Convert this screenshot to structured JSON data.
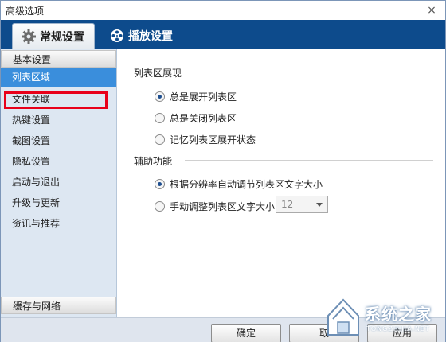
{
  "window": {
    "title": "高级选项",
    "close_glyph": "×"
  },
  "tabs": [
    {
      "label": "常规设置",
      "icon": "gear-icon",
      "active": true
    },
    {
      "label": "播放设置",
      "icon": "film-reel-icon",
      "active": false
    }
  ],
  "sidebar": {
    "top_header": "基本设置",
    "items": [
      {
        "label": "列表区域",
        "selected": true
      },
      {
        "label": "文件关联",
        "selected": false
      },
      {
        "label": "热键设置",
        "selected": false
      },
      {
        "label": "截图设置",
        "selected": false
      },
      {
        "label": "隐私设置",
        "selected": false
      },
      {
        "label": "启动与退出",
        "selected": false
      },
      {
        "label": "升级与更新",
        "selected": false
      },
      {
        "label": "资讯与推荐",
        "selected": false
      }
    ],
    "bottom_header": "缓存与网络"
  },
  "main": {
    "section1": {
      "title": "列表区展现",
      "options": [
        {
          "label": "总是展开列表区",
          "checked": true
        },
        {
          "label": "总是关闭列表区",
          "checked": false
        },
        {
          "label": "记忆列表区展开状态",
          "checked": false
        }
      ]
    },
    "section2": {
      "title": "辅助功能",
      "options": [
        {
          "label": "根据分辨率自动调节列表区文字大小",
          "checked": true
        },
        {
          "label": "手动调整列表区文字大小",
          "checked": false
        }
      ],
      "font_size_select": {
        "value": "12"
      }
    }
  },
  "footer": {
    "ok_label": "确定",
    "cancel_label": "取",
    "apply_label": "应用"
  },
  "watermark": {
    "text": "系统之家",
    "sub": "TONGZHIJIA.NET"
  },
  "colors": {
    "tabbar": "#0d4b8c",
    "selected_item": "#3a8edc",
    "highlight": "#e8001a"
  }
}
